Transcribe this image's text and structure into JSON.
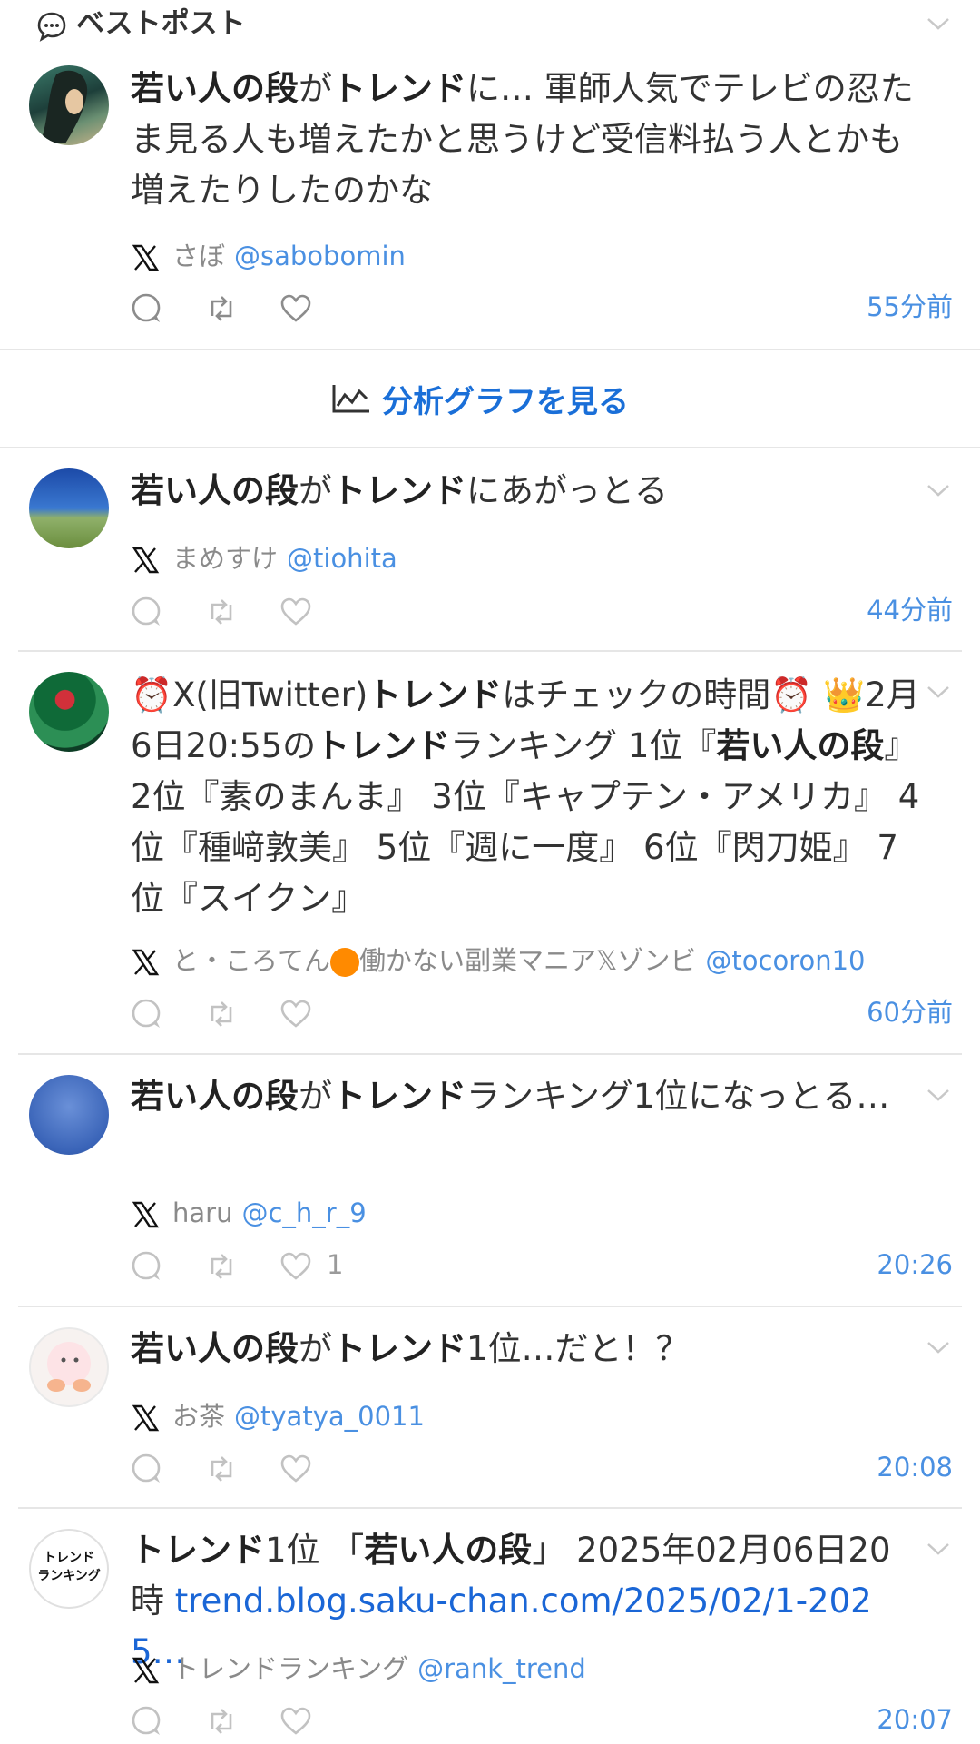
{
  "header": {
    "title": "ベストポスト"
  },
  "analysis": {
    "label": "分析グラフを見る"
  },
  "posts": [
    {
      "segments": [
        {
          "t": "若い人の段",
          "b": true
        },
        {
          "t": "が",
          "b": false
        },
        {
          "t": "トレンド",
          "b": true
        },
        {
          "t": "に… 軍師人気でテレビの忍たま見る人も増えたかと思うけど受信料払う人とかも増えたりしたのかな",
          "b": false
        }
      ],
      "name": "さぼ",
      "handle": "@sabobomin",
      "likes": "",
      "time": "55分前"
    },
    {
      "segments": [
        {
          "t": "若い人の段",
          "b": true
        },
        {
          "t": "が",
          "b": false
        },
        {
          "t": "トレンド",
          "b": true
        },
        {
          "t": "にあがっとる",
          "b": false
        }
      ],
      "name": "まめすけ",
      "handle": "@tiohita",
      "likes": "",
      "time": "44分前"
    },
    {
      "segments": [
        {
          "t": "⏰X(旧Twitter)",
          "b": false
        },
        {
          "t": "トレンド",
          "b": true
        },
        {
          "t": "はチェックの時間⏰ 👑2月6日20:55の",
          "b": false
        },
        {
          "t": "トレンド",
          "b": true
        },
        {
          "t": "ランキング 1位『",
          "b": false
        },
        {
          "t": "若い人の段",
          "b": true
        },
        {
          "t": "』 2位『素のまんま』 3位『キャプテン・アメリカ』 4位『種﨑敦美』 5位『週に一度』 6位『閃刀姫』 7位『スイクン』",
          "b": false
        }
      ],
      "name_pre": "と・ころてん",
      "name_post": "働かない副業マニア𝕏ゾンビ",
      "handle": "@tocoron10",
      "likes": "",
      "time": "60分前"
    },
    {
      "segments": [
        {
          "t": "若い人の段",
          "b": true
        },
        {
          "t": "が",
          "b": false
        },
        {
          "t": "トレンド",
          "b": true
        },
        {
          "t": "ランキング1位になっとる…",
          "b": false
        }
      ],
      "name": "haru",
      "handle": "@c_h_r_9",
      "likes": "1",
      "time": "20:26"
    },
    {
      "segments": [
        {
          "t": "若い人の段",
          "b": true
        },
        {
          "t": "が",
          "b": false
        },
        {
          "t": "トレンド",
          "b": true
        },
        {
          "t": "1位…だと！？",
          "b": false
        }
      ],
      "name": "お茶",
      "handle": "@tyatya_0011",
      "likes": "",
      "time": "20:08"
    },
    {
      "segments": [
        {
          "t": "トレンド",
          "b": true
        },
        {
          "t": "1位 「",
          "b": false
        },
        {
          "t": "若い人の段",
          "b": true
        },
        {
          "t": "」 2025年02月06日20時 ",
          "b": false
        },
        {
          "t": "trend.blog.saku-chan.com/2025/02/1-2025…",
          "link": true
        }
      ],
      "name": "トレンドランキング",
      "handle": "@rank_trend",
      "likes": "",
      "time": "20:07"
    }
  ],
  "avatar_logo": {
    "line1": "トレンド",
    "line2": "ランキング"
  },
  "colors": {
    "accent": "#1a6fd8",
    "handle": "#4a90e2",
    "divider": "#e6e6e6"
  }
}
